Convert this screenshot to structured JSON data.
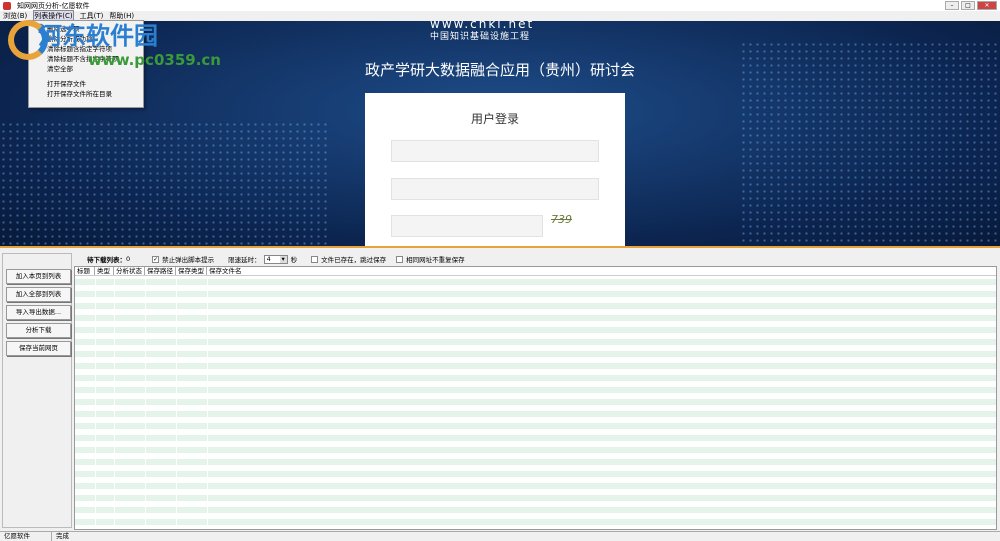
{
  "window": {
    "title": "知网网页分析-亿愿软件"
  },
  "menubar": [
    "浏览(B)",
    "列表操作(C)",
    "工具(T)",
    "帮助(H)"
  ],
  "dropdown": [
    "删除选中项",
    "删除分析成功项",
    "清除标题含指定字符项",
    "清除标题不含指定字符项",
    "清空全部",
    "打开保存文件",
    "打开保存文件所在目录"
  ],
  "banner": {
    "site": "www.cnki.net",
    "subtitle": "中国知识基础设施工程",
    "title": "政产学研大数据融合应用（贵州）研讨会",
    "login_title": "用户登录",
    "captcha": "739"
  },
  "watermark": {
    "name": "河东软件园",
    "url": "www.pc0359.cn"
  },
  "buttons": [
    "加入本页到列表",
    "加入全部到列表",
    "导入导出数据...",
    "分析下载",
    "保存当前网页"
  ],
  "options": {
    "queue_label": "待下载列表：",
    "queue_count": "0",
    "disable_popup": "禁止弹出脚本提示",
    "disable_popup_checked": true,
    "timeout_label": "限速延时：",
    "timeout_value": "4",
    "timeout_unit": "秒",
    "skip_existing": "文件已存在，跳过保存",
    "skip_existing_checked": false,
    "no_dup": "相同网址不重复保存",
    "no_dup_checked": false
  },
  "table": {
    "columns": [
      "标题",
      "类型",
      "分析状态",
      "保存路径",
      "保存类型",
      "保存文件名"
    ]
  },
  "status": [
    "亿愿软件",
    "完成"
  ]
}
